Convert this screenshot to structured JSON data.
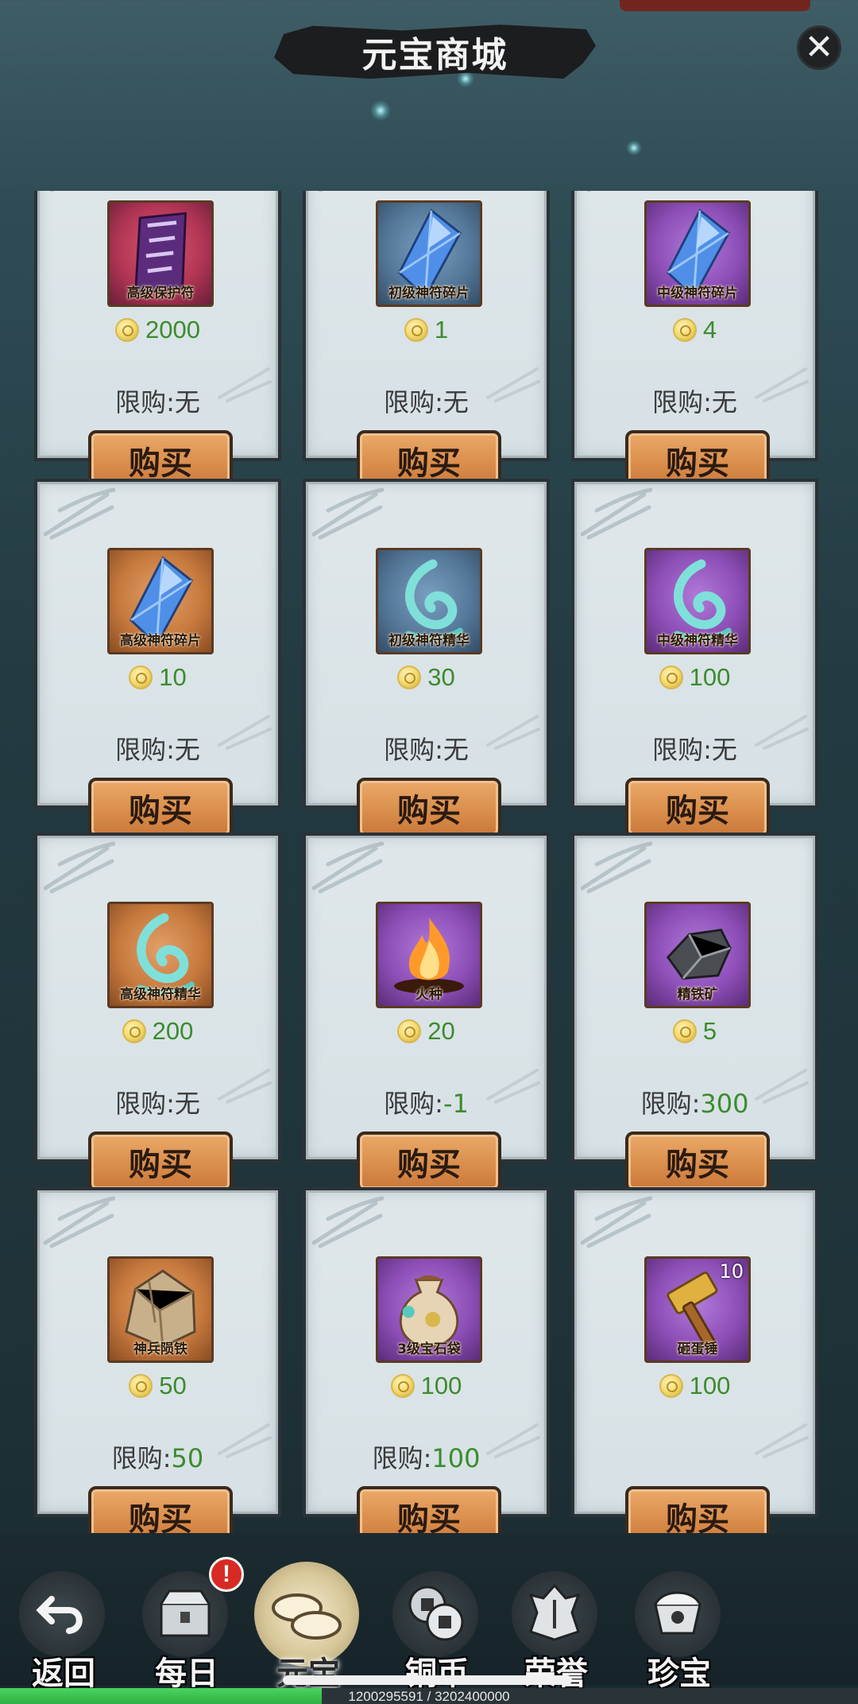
{
  "window": {
    "title": "元宝商城",
    "close_icon": "close-icon"
  },
  "items": [
    {
      "name": "高级保护符",
      "icon": "scroll-icon",
      "frame": "red",
      "price": "2000",
      "limit_label": "限购:",
      "limit_value": "无",
      "limit_green": false,
      "buy_label": "购买"
    },
    {
      "name": "初级神符碎片",
      "icon": "crystal-icon",
      "frame": "blue",
      "price": "1",
      "limit_label": "限购:",
      "limit_value": "无",
      "limit_green": false,
      "buy_label": "购买"
    },
    {
      "name": "中级神符碎片",
      "icon": "crystal-icon",
      "frame": "purple",
      "price": "4",
      "limit_label": "限购:",
      "limit_value": "无",
      "limit_green": false,
      "buy_label": "购买"
    },
    {
      "name": "高级神符碎片",
      "icon": "crystal-icon",
      "frame": "orange",
      "price": "10",
      "limit_label": "限购:",
      "limit_value": "无",
      "limit_green": false,
      "buy_label": "购买"
    },
    {
      "name": "初级神符精华",
      "icon": "swirl-icon",
      "frame": "blue",
      "price": "30",
      "limit_label": "限购:",
      "limit_value": "无",
      "limit_green": false,
      "buy_label": "购买"
    },
    {
      "name": "中级神符精华",
      "icon": "swirl-icon",
      "frame": "purple",
      "price": "100",
      "limit_label": "限购:",
      "limit_value": "无",
      "limit_green": false,
      "buy_label": "购买"
    },
    {
      "name": "高级神符精华",
      "icon": "swirl-icon",
      "frame": "orange",
      "price": "200",
      "limit_label": "限购:",
      "limit_value": "无",
      "limit_green": false,
      "buy_label": "购买"
    },
    {
      "name": "火种",
      "icon": "fire-icon",
      "frame": "purple",
      "price": "20",
      "limit_label": "限购:",
      "limit_value": "-1",
      "limit_green": true,
      "buy_label": "购买"
    },
    {
      "name": "精铁矿",
      "icon": "ore-icon",
      "frame": "purple",
      "price": "5",
      "limit_label": "限购:",
      "limit_value": "300",
      "limit_green": true,
      "buy_label": "购买"
    },
    {
      "name": "神兵陨铁",
      "icon": "meteorite-icon",
      "frame": "orange",
      "price": "50",
      "limit_label": "限购:",
      "limit_value": "50",
      "limit_green": true,
      "buy_label": "购买"
    },
    {
      "name": "3级宝石袋",
      "icon": "gem-bag-icon",
      "frame": "purple",
      "price": "100",
      "limit_label": "限购:",
      "limit_value": "100",
      "limit_green": true,
      "buy_label": "购买"
    },
    {
      "name": "砸蛋锤",
      "icon": "hammer-icon",
      "frame": "purple",
      "price": "100",
      "limit_label": "",
      "limit_value": "",
      "limit_green": false,
      "buy_label": "购买",
      "count": "10"
    }
  ],
  "tabs": [
    {
      "label": "返回",
      "icon": "back-arrow-icon",
      "active": false
    },
    {
      "label": "每日",
      "icon": "chest-icon",
      "active": false,
      "badge": "!"
    },
    {
      "label": "元宝",
      "icon": "ingot-icon",
      "active": true
    },
    {
      "label": "铜币",
      "icon": "copper-coin-icon",
      "active": false
    },
    {
      "label": "荣誉",
      "icon": "honor-emblem-icon",
      "active": false
    },
    {
      "label": "珍宝",
      "icon": "treasure-icon",
      "active": false
    }
  ],
  "progress": {
    "text": "1200295591 / 3202400000",
    "fraction": 0.3748
  },
  "colors": {
    "price_green": "#3c8b2e",
    "buy_button": "#d98c4a",
    "badge_red": "#d82a24"
  }
}
